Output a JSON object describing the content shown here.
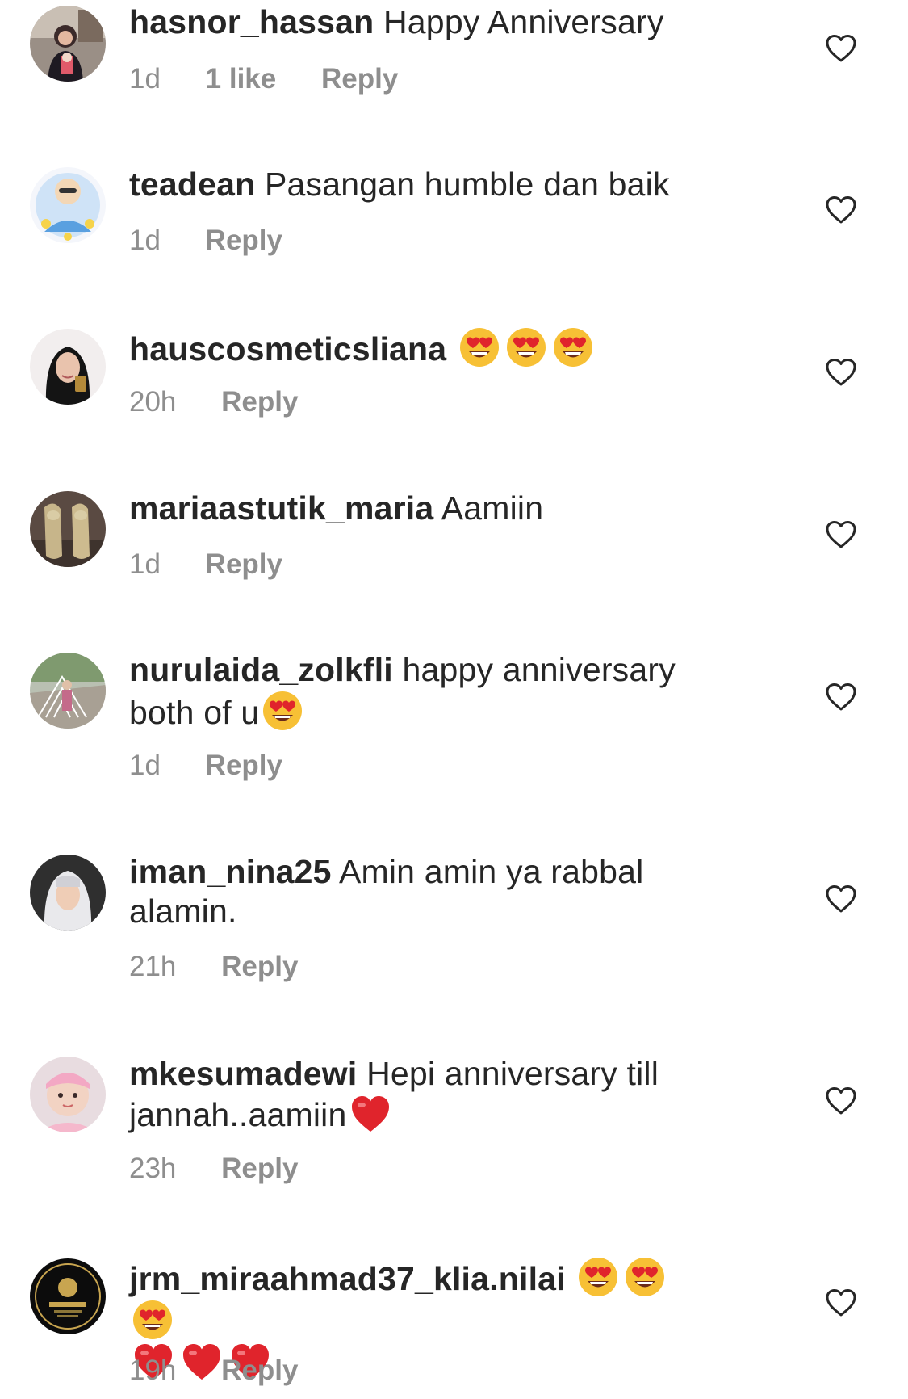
{
  "icons": {
    "like_icon": "heart-outline-icon",
    "emoji_heart_eyes": "smiling-face-with-heart-eyes-emoji",
    "emoji_red_heart": "red-heart-emoji"
  },
  "colors": {
    "text": "#262626",
    "meta": "#8e8e8e",
    "emoji_face": "#f7c035",
    "emoji_heart": "#e0242c"
  },
  "comments": [
    {
      "username": "hasnor_hassan",
      "text": "Happy Anniversary",
      "time": "1d",
      "likes": "1 like",
      "reply": "Reply"
    },
    {
      "username": "teadean",
      "text": "Pasangan humble dan baik",
      "time": "1d",
      "reply": "Reply"
    },
    {
      "username": "hauscosmeticsliana",
      "text": "",
      "time": "20h",
      "reply": "Reply"
    },
    {
      "username": "mariaastutik_maria",
      "text": "Aamiin",
      "time": "1d",
      "reply": "Reply"
    },
    {
      "username": "nurulaida_zolkfli",
      "text": "happy anniversary both of u",
      "time": "1d",
      "reply": "Reply"
    },
    {
      "username": "iman_nina25",
      "text": "Amin amin ya rabbal alamin.",
      "time": "21h",
      "reply": "Reply"
    },
    {
      "username": "mkesumadewi",
      "text": "Hepi anniversary till jannah..aamiin",
      "time": "23h",
      "reply": "Reply"
    },
    {
      "username": "jrm_miraahmad37_klia.nilai",
      "text": "",
      "time": "19h",
      "reply": "Reply"
    }
  ]
}
